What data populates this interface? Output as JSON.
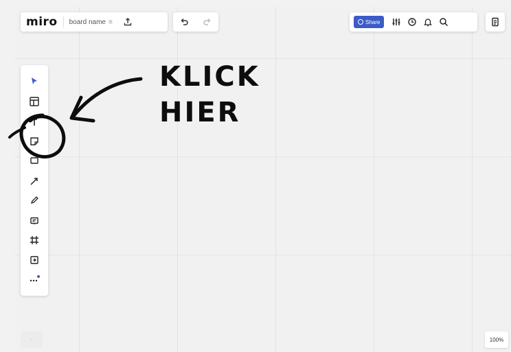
{
  "header": {
    "logo": "miro",
    "board_name": "board name",
    "board_menu": "≡"
  },
  "share": {
    "label": "Share"
  },
  "annotation": {
    "line1": "KLICK",
    "line2": "HIER"
  },
  "zoom": {
    "left_label": "−",
    "level": "100%"
  },
  "toolbar": {
    "tools": [
      "select",
      "templates",
      "text",
      "sticky-note",
      "shapes",
      "connection-line",
      "pen",
      "comment",
      "frame",
      "upload",
      "more"
    ]
  },
  "icons": [
    "export-icon",
    "undo-icon",
    "redo-icon",
    "settings-icon",
    "timer-icon",
    "notifications-icon",
    "search-icon",
    "board-list-icon"
  ],
  "colors": {
    "accent": "#3b5cc6",
    "select_tool": "#3b5cc6",
    "annotation": "#0d0d0d"
  }
}
